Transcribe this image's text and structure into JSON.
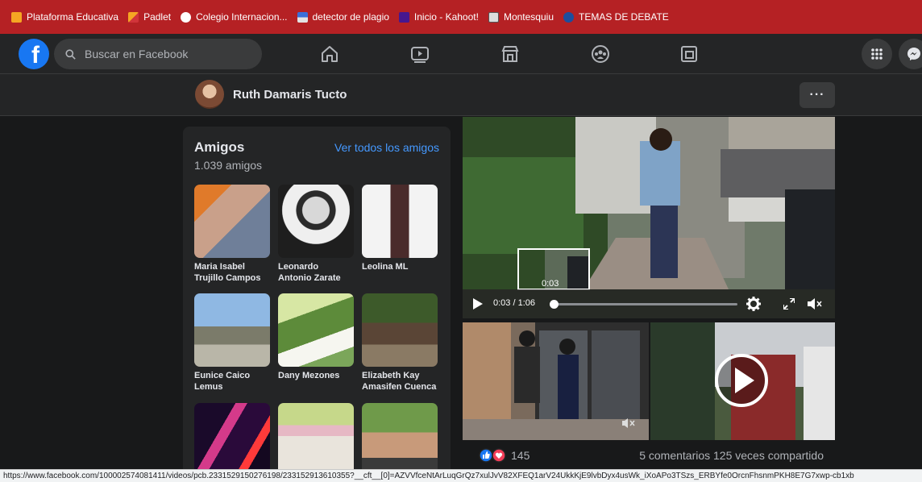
{
  "bookmarks": [
    {
      "label": "Plataforma Educativa",
      "color": "#f5a623"
    },
    {
      "label": "Padlet",
      "color": "#1a1a1a"
    },
    {
      "label": "Colegio Internacion...",
      "color": "#ffffff"
    },
    {
      "label": "detector de plagio",
      "color": "#3a6fd8"
    },
    {
      "label": "Inicio - Kahoot!",
      "color": "#46178f"
    },
    {
      "label": "Montesquiu",
      "color": "#dddddd"
    },
    {
      "label": "TEMAS DE DEBATE",
      "color": "#1c4e9e"
    }
  ],
  "topbar": {
    "logo": "f",
    "search_placeholder": "Buscar en Facebook"
  },
  "profile": {
    "name": "Ruth Damaris Tucto",
    "more_label": "···"
  },
  "friends": {
    "title": "Amigos",
    "count": "1.039 amigos",
    "see_all": "Ver todos los amigos",
    "items": [
      {
        "name": "Maria Isabel Trujillo Campos"
      },
      {
        "name": "Leonardo Antonio Zarate"
      },
      {
        "name": "Leolina ML"
      },
      {
        "name": "Eunice Caico Lemus"
      },
      {
        "name": "Dany Mezones"
      },
      {
        "name": "Elizabeth Kay Amasifen Cuenca"
      },
      {
        "name": ""
      },
      {
        "name": ""
      },
      {
        "name": ""
      }
    ]
  },
  "video": {
    "time": "0:03 / 1:06",
    "preview_time": "0:03",
    "progress": 0.02
  },
  "post": {
    "reactions": "145",
    "comments_shares": "5 comentarios  125 veces compartido"
  },
  "status_url": "https://www.facebook.com/100002574081411/videos/pcb.2331529150276198/2331529136103​55?__cft__[0]=AZVVfceNtArLuqGrQz7xulJvV82XFEQ1arV24UkkKjE9lvbDyx4usWk_iXoAPo3TSzs_ERBYfe0OrcnFhsnmPKH8E7G7xwp-cb1xb"
}
